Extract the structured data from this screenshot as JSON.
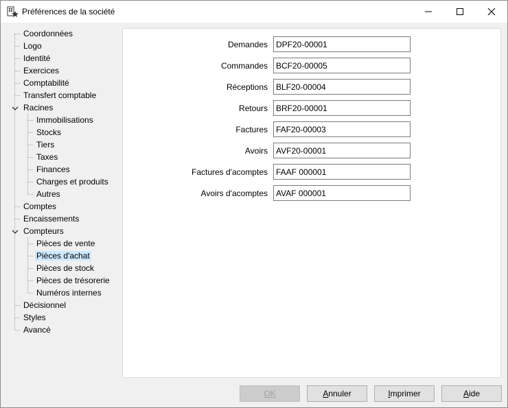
{
  "window": {
    "title": "Préférences de la société",
    "icon": "building-star-icon"
  },
  "tree": {
    "items": [
      {
        "label": "Coordonnées"
      },
      {
        "label": "Logo"
      },
      {
        "label": "Identité"
      },
      {
        "label": "Exercices"
      },
      {
        "label": "Comptabilité"
      },
      {
        "label": "Transfert comptable"
      },
      {
        "label": "Racines",
        "expanded": true,
        "children": [
          {
            "label": "Immobilisations"
          },
          {
            "label": "Stocks"
          },
          {
            "label": "Tiers"
          },
          {
            "label": "Taxes"
          },
          {
            "label": "Finances"
          },
          {
            "label": "Charges et produits"
          },
          {
            "label": "Autres"
          }
        ]
      },
      {
        "label": "Comptes"
      },
      {
        "label": "Encaissements"
      },
      {
        "label": "Compteurs",
        "expanded": true,
        "children": [
          {
            "label": "Pièces de vente"
          },
          {
            "label": "Pièces d'achat",
            "selected": true
          },
          {
            "label": "Pièces de stock"
          },
          {
            "label": "Pièces de trésorerie"
          },
          {
            "label": "Numéros internes"
          }
        ]
      },
      {
        "label": "Décisionnel"
      },
      {
        "label": "Styles"
      },
      {
        "label": "Avancé"
      }
    ]
  },
  "form": {
    "rows": [
      {
        "label": "Demandes",
        "value": "DPF20-00001"
      },
      {
        "label": "Commandes",
        "value": "BCF20-00005"
      },
      {
        "label": "Réceptions",
        "value": "BLF20-00004"
      },
      {
        "label": "Retours",
        "value": "BRF20-00001"
      },
      {
        "label": "Factures",
        "value": "FAF20-00003"
      },
      {
        "label": "Avoirs",
        "value": "AVF20-00001"
      },
      {
        "label": "Factures d'acomptes",
        "value": "FAAF 000001"
      },
      {
        "label": "Avoirs d'acomptes",
        "value": "AVAF 000001"
      }
    ]
  },
  "buttons": {
    "ok": {
      "label": "OK",
      "mnemonic": "O",
      "enabled": false
    },
    "cancel": {
      "label": "Annuler",
      "mnemonic": "A"
    },
    "print": {
      "label": "Imprimer",
      "mnemonic": "I"
    },
    "help": {
      "label": "Aide",
      "mnemonic": "A"
    }
  }
}
